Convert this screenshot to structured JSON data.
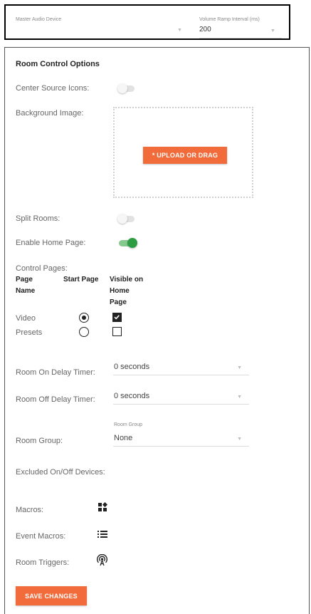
{
  "audio": {
    "master_audio_device_label": "Master Audio Device",
    "master_audio_device_value": "",
    "volume_ramp_label": "Volume Ramp Interval (ms)",
    "volume_ramp_value": "200"
  },
  "room_control": {
    "title": "Room Control Options",
    "center_source_icons_label": "Center Source Icons:",
    "center_source_icons_on": false,
    "background_image_label": "Background Image:",
    "upload_button": "* UPLOAD OR DRAG",
    "split_rooms_label": "Split Rooms:",
    "split_rooms_on": false,
    "enable_home_page_label": "Enable Home Page:",
    "enable_home_page_on": true,
    "control_pages_label": "Control Pages:",
    "columns": {
      "page_name": [
        "Page",
        "Name"
      ],
      "start_page": "Start Page",
      "visible_home": [
        "Visible on",
        "Home",
        "Page"
      ]
    },
    "pages": [
      {
        "name": "Video",
        "start_page": true,
        "visible_on_home": true
      },
      {
        "name": "Presets",
        "start_page": false,
        "visible_on_home": false
      }
    ],
    "room_on_delay_label": "Room On Delay Timer:",
    "room_on_delay_value": "0 seconds",
    "room_off_delay_label": "Room Off Delay Timer:",
    "room_off_delay_value": "0 seconds",
    "room_group_label": "Room Group:",
    "room_group_field_label": "Room Group",
    "room_group_value": "None",
    "excluded_devices_label": "Excluded On/Off Devices:",
    "macros_label": "Macros:",
    "macros_icon": "widgets-icon",
    "event_macros_label": "Event Macros:",
    "event_macros_icon": "list-icon",
    "room_triggers_label": "Room Triggers:",
    "room_triggers_icon": "antenna-icon",
    "save_button": "SAVE CHANGES"
  },
  "colors": {
    "accent": "#f26b3a",
    "toggle_on": "#2e9c43"
  }
}
